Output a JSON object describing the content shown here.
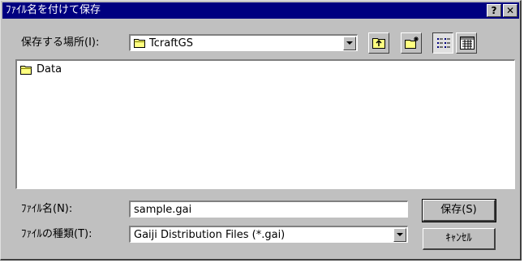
{
  "window": {
    "title": "ﾌｧｲﾙ名を付けて保存",
    "help_label": "?",
    "close_label": "✕"
  },
  "location": {
    "label": "保存する場所(I):",
    "value": "TcraftGS"
  },
  "file_list": [
    {
      "name": "Data"
    }
  ],
  "filename": {
    "label": "ﾌｧｲﾙ名(N):",
    "value": "sample.gai"
  },
  "filetype": {
    "label": "ﾌｧｲﾙの種類(T):",
    "value": "Gaiji Distribution Files (*.gai)"
  },
  "buttons": {
    "save_label": "保存(S)",
    "cancel_label": "ｷｬﾝｾﾙ"
  },
  "colors": {
    "titlebar": "#000080",
    "face": "#c0c0c0",
    "folder": "#ffff80"
  }
}
